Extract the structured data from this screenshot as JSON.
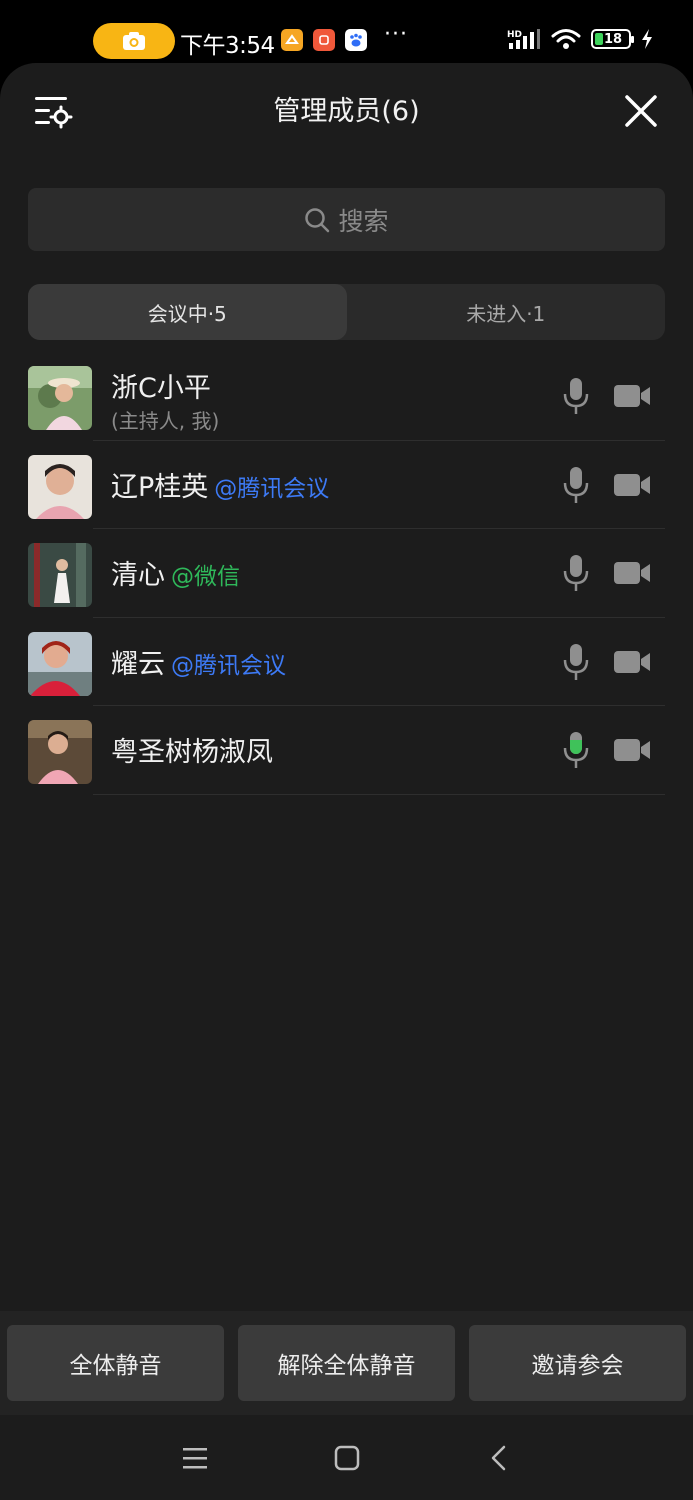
{
  "status_bar": {
    "time": "下午3:54",
    "overflow": "···",
    "network": "HD",
    "battery_level": "18",
    "icons": [
      "camera-recording-icon",
      "app-orange-icon",
      "app-red-icon",
      "baidu-icon",
      "signal-icon",
      "wifi-icon",
      "battery-icon",
      "charging-icon"
    ]
  },
  "header": {
    "title": "管理成员(6)",
    "settings_icon": "list-settings-icon",
    "close_icon": "close-icon"
  },
  "search": {
    "placeholder": "搜索"
  },
  "tabs": [
    {
      "label": "会议中·5",
      "active": true
    },
    {
      "label": "未进入·1",
      "active": false
    }
  ],
  "members": [
    {
      "name": "浙C小平",
      "source": "",
      "subtitle": "(主持人, 我)",
      "mic": "off",
      "camera": "off"
    },
    {
      "name": "辽P桂英",
      "source": "@腾讯会议",
      "source_color": "#3d7af5",
      "subtitle": "",
      "mic": "off",
      "camera": "off"
    },
    {
      "name": "清心",
      "source": "@微信",
      "source_color": "#2fb85a",
      "subtitle": "",
      "mic": "off",
      "camera": "off"
    },
    {
      "name": "耀云",
      "source": "@腾讯会议",
      "source_color": "#3d7af5",
      "subtitle": "",
      "mic": "off",
      "camera": "off"
    },
    {
      "name": "粤圣树杨淑凤",
      "source": "",
      "subtitle": "",
      "mic": "active",
      "camera": "off"
    }
  ],
  "actions": {
    "mute_all": "全体静音",
    "unmute_all": "解除全体静音",
    "invite": "邀请参会"
  },
  "colors": {
    "accent_green": "#3fc25a",
    "link_blue": "#3d7af5",
    "background": "#1c1c1c"
  }
}
